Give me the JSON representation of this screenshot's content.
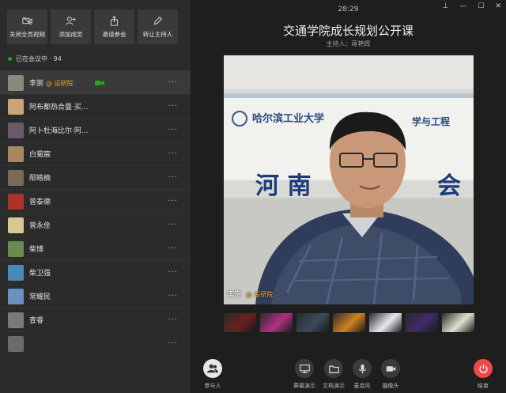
{
  "toolbar": {
    "buttons": [
      {
        "label": "关闭全员视频",
        "icon": "video-off-icon"
      },
      {
        "label": "添加成员",
        "icon": "add-user-icon"
      },
      {
        "label": "邀请参会",
        "icon": "share-icon"
      },
      {
        "label": "转让主持人",
        "icon": "pen-icon"
      }
    ]
  },
  "meeting_status": "已在会议中 · 94",
  "participants": [
    {
      "name": "李崇",
      "tag": "@ 设研院",
      "video": true,
      "avatar_color": "#8a8a7a"
    },
    {
      "name": "阿布都热合曼·买...",
      "tag": "",
      "avatar_color": "#c9a47a"
    },
    {
      "name": "阿卜杜海比尔·阿...",
      "tag": "",
      "avatar_color": "#6a5a6a"
    },
    {
      "name": "白菊宸",
      "tag": "",
      "avatar_color": "#a88860"
    },
    {
      "name": "邴皓楠",
      "tag": "",
      "avatar_color": "#7a6a58"
    },
    {
      "name": "曾泰德",
      "tag": "",
      "avatar_color": "#b0302a"
    },
    {
      "name": "曾永佺",
      "tag": "",
      "avatar_color": "#d8c890"
    },
    {
      "name": "柴博",
      "tag": "",
      "avatar_color": "#6a8a50"
    },
    {
      "name": "柴卫强",
      "tag": "",
      "avatar_color": "#4a8ab8"
    },
    {
      "name": "常耀民",
      "tag": "",
      "avatar_color": "#6a90c0"
    },
    {
      "name": "查睿",
      "tag": "",
      "avatar_color": "#7a7a7a"
    },
    {
      "name": "",
      "tag": "",
      "avatar_color": "#6a6a6a"
    }
  ],
  "header": {
    "time": "28:29",
    "title": "交通学院成长规划公开课",
    "host": "主持人：蒋艳辉"
  },
  "video": {
    "speaker_name": "李崇",
    "speaker_tag": "@ 设研院",
    "banner_text_1": "哈尔滨工业大学",
    "banner_text_2": "学与工程",
    "banner_text_3": "河 南",
    "banner_text_4": "会"
  },
  "thumbnails": [
    "#6a2020",
    "#b03080",
    "#3a4a5a",
    "#d08020",
    "#e8e8f0",
    "#402a6a",
    "#e0e0d0"
  ],
  "bottom_bar": {
    "participants_label": "参与人",
    "screen_share_label": "屏幕演示",
    "doc_share_label": "文档演示",
    "mic_label": "麦克风",
    "camera_label": "摄像头",
    "end_label": "结束"
  },
  "colors": {
    "accent_green": "#1aad19",
    "end_red": "#f04848",
    "tag_orange": "#e2a033"
  }
}
